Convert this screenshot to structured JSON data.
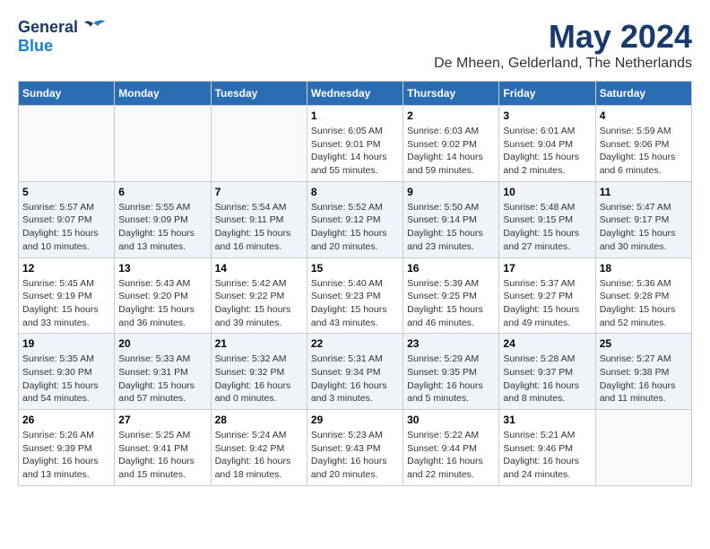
{
  "logo": {
    "general": "General",
    "blue": "Blue"
  },
  "title": "May 2024",
  "location": "De Mheen, Gelderland, The Netherlands",
  "days_of_week": [
    "Sunday",
    "Monday",
    "Tuesday",
    "Wednesday",
    "Thursday",
    "Friday",
    "Saturday"
  ],
  "weeks": [
    [
      {
        "day": "",
        "info": ""
      },
      {
        "day": "",
        "info": ""
      },
      {
        "day": "",
        "info": ""
      },
      {
        "day": "1",
        "info": "Sunrise: 6:05 AM\nSunset: 9:01 PM\nDaylight: 14 hours\nand 55 minutes."
      },
      {
        "day": "2",
        "info": "Sunrise: 6:03 AM\nSunset: 9:02 PM\nDaylight: 14 hours\nand 59 minutes."
      },
      {
        "day": "3",
        "info": "Sunrise: 6:01 AM\nSunset: 9:04 PM\nDaylight: 15 hours\nand 2 minutes."
      },
      {
        "day": "4",
        "info": "Sunrise: 5:59 AM\nSunset: 9:06 PM\nDaylight: 15 hours\nand 6 minutes."
      }
    ],
    [
      {
        "day": "5",
        "info": "Sunrise: 5:57 AM\nSunset: 9:07 PM\nDaylight: 15 hours\nand 10 minutes."
      },
      {
        "day": "6",
        "info": "Sunrise: 5:55 AM\nSunset: 9:09 PM\nDaylight: 15 hours\nand 13 minutes."
      },
      {
        "day": "7",
        "info": "Sunrise: 5:54 AM\nSunset: 9:11 PM\nDaylight: 15 hours\nand 16 minutes."
      },
      {
        "day": "8",
        "info": "Sunrise: 5:52 AM\nSunset: 9:12 PM\nDaylight: 15 hours\nand 20 minutes."
      },
      {
        "day": "9",
        "info": "Sunrise: 5:50 AM\nSunset: 9:14 PM\nDaylight: 15 hours\nand 23 minutes."
      },
      {
        "day": "10",
        "info": "Sunrise: 5:48 AM\nSunset: 9:15 PM\nDaylight: 15 hours\nand 27 minutes."
      },
      {
        "day": "11",
        "info": "Sunrise: 5:47 AM\nSunset: 9:17 PM\nDaylight: 15 hours\nand 30 minutes."
      }
    ],
    [
      {
        "day": "12",
        "info": "Sunrise: 5:45 AM\nSunset: 9:19 PM\nDaylight: 15 hours\nand 33 minutes."
      },
      {
        "day": "13",
        "info": "Sunrise: 5:43 AM\nSunset: 9:20 PM\nDaylight: 15 hours\nand 36 minutes."
      },
      {
        "day": "14",
        "info": "Sunrise: 5:42 AM\nSunset: 9:22 PM\nDaylight: 15 hours\nand 39 minutes."
      },
      {
        "day": "15",
        "info": "Sunrise: 5:40 AM\nSunset: 9:23 PM\nDaylight: 15 hours\nand 43 minutes."
      },
      {
        "day": "16",
        "info": "Sunrise: 5:39 AM\nSunset: 9:25 PM\nDaylight: 15 hours\nand 46 minutes."
      },
      {
        "day": "17",
        "info": "Sunrise: 5:37 AM\nSunset: 9:27 PM\nDaylight: 15 hours\nand 49 minutes."
      },
      {
        "day": "18",
        "info": "Sunrise: 5:36 AM\nSunset: 9:28 PM\nDaylight: 15 hours\nand 52 minutes."
      }
    ],
    [
      {
        "day": "19",
        "info": "Sunrise: 5:35 AM\nSunset: 9:30 PM\nDaylight: 15 hours\nand 54 minutes."
      },
      {
        "day": "20",
        "info": "Sunrise: 5:33 AM\nSunset: 9:31 PM\nDaylight: 15 hours\nand 57 minutes."
      },
      {
        "day": "21",
        "info": "Sunrise: 5:32 AM\nSunset: 9:32 PM\nDaylight: 16 hours\nand 0 minutes."
      },
      {
        "day": "22",
        "info": "Sunrise: 5:31 AM\nSunset: 9:34 PM\nDaylight: 16 hours\nand 3 minutes."
      },
      {
        "day": "23",
        "info": "Sunrise: 5:29 AM\nSunset: 9:35 PM\nDaylight: 16 hours\nand 5 minutes."
      },
      {
        "day": "24",
        "info": "Sunrise: 5:28 AM\nSunset: 9:37 PM\nDaylight: 16 hours\nand 8 minutes."
      },
      {
        "day": "25",
        "info": "Sunrise: 5:27 AM\nSunset: 9:38 PM\nDaylight: 16 hours\nand 11 minutes."
      }
    ],
    [
      {
        "day": "26",
        "info": "Sunrise: 5:26 AM\nSunset: 9:39 PM\nDaylight: 16 hours\nand 13 minutes."
      },
      {
        "day": "27",
        "info": "Sunrise: 5:25 AM\nSunset: 9:41 PM\nDaylight: 16 hours\nand 15 minutes."
      },
      {
        "day": "28",
        "info": "Sunrise: 5:24 AM\nSunset: 9:42 PM\nDaylight: 16 hours\nand 18 minutes."
      },
      {
        "day": "29",
        "info": "Sunrise: 5:23 AM\nSunset: 9:43 PM\nDaylight: 16 hours\nand 20 minutes."
      },
      {
        "day": "30",
        "info": "Sunrise: 5:22 AM\nSunset: 9:44 PM\nDaylight: 16 hours\nand 22 minutes."
      },
      {
        "day": "31",
        "info": "Sunrise: 5:21 AM\nSunset: 9:46 PM\nDaylight: 16 hours\nand 24 minutes."
      },
      {
        "day": "",
        "info": ""
      }
    ]
  ]
}
